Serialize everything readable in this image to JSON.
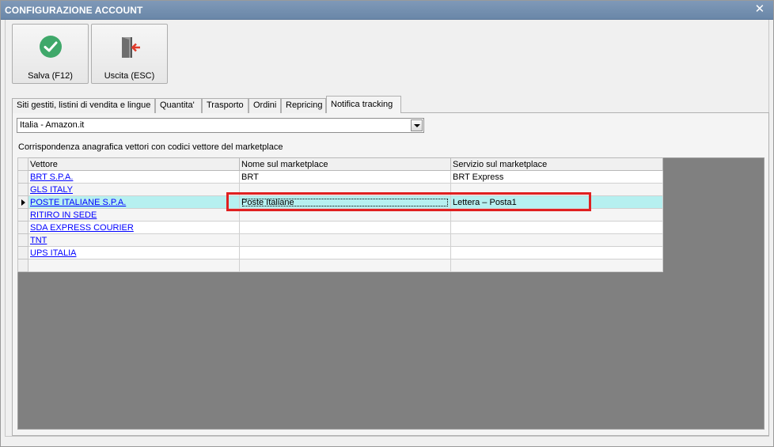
{
  "window": {
    "title": "CONFIGURAZIONE ACCOUNT",
    "close_glyph": "✕"
  },
  "toolbar": {
    "save_label": "Salva (F12)",
    "exit_label": "Uscita (ESC)"
  },
  "tabs": [
    {
      "label": "Siti gestiti, listini di vendita e lingue",
      "active": false
    },
    {
      "label": "Quantita'",
      "active": false
    },
    {
      "label": "Trasporto",
      "active": false
    },
    {
      "label": "Ordini",
      "active": false
    },
    {
      "label": "Repricing",
      "active": false
    },
    {
      "label": "Notifica tracking",
      "active": true
    }
  ],
  "marketplace_select": {
    "value": "Italia - Amazon.it"
  },
  "section_label": "Corrispondenza anagrafica vettori con codici vettore del marketplace",
  "grid": {
    "columns": [
      "Vettore",
      "Nome sul marketplace",
      "Servizio sul marketplace"
    ],
    "rows": [
      {
        "vettore": "BRT S.P.A.",
        "nome": "BRT",
        "servizio": "BRT Express"
      },
      {
        "vettore": "GLS ITALY",
        "nome": "",
        "servizio": ""
      },
      {
        "vettore": "POSTE ITALIANE S.P.A.",
        "nome": "Poste Italiane",
        "servizio": "Lettera – Posta1"
      },
      {
        "vettore": "RITIRO IN SEDE",
        "nome": "",
        "servizio": ""
      },
      {
        "vettore": "SDA EXPRESS COURIER",
        "nome": "",
        "servizio": ""
      },
      {
        "vettore": "TNT",
        "nome": "",
        "servizio": ""
      },
      {
        "vettore": "UPS ITALIA",
        "nome": "",
        "servizio": ""
      },
      {
        "vettore": "",
        "nome": "",
        "servizio": ""
      }
    ]
  },
  "colors": {
    "titlebar": "#7490b2",
    "selected_row": "#b6f0f0",
    "highlight": "#e02020",
    "save_icon": "#3fa86a",
    "exit_arrow": "#e03a2a",
    "link": "#0000ff"
  },
  "icons": {
    "save": "check-circle-icon",
    "exit": "door-exit-icon",
    "row_pointer": "row-pointer-icon",
    "dropdown": "dropdown-arrow-icon"
  }
}
